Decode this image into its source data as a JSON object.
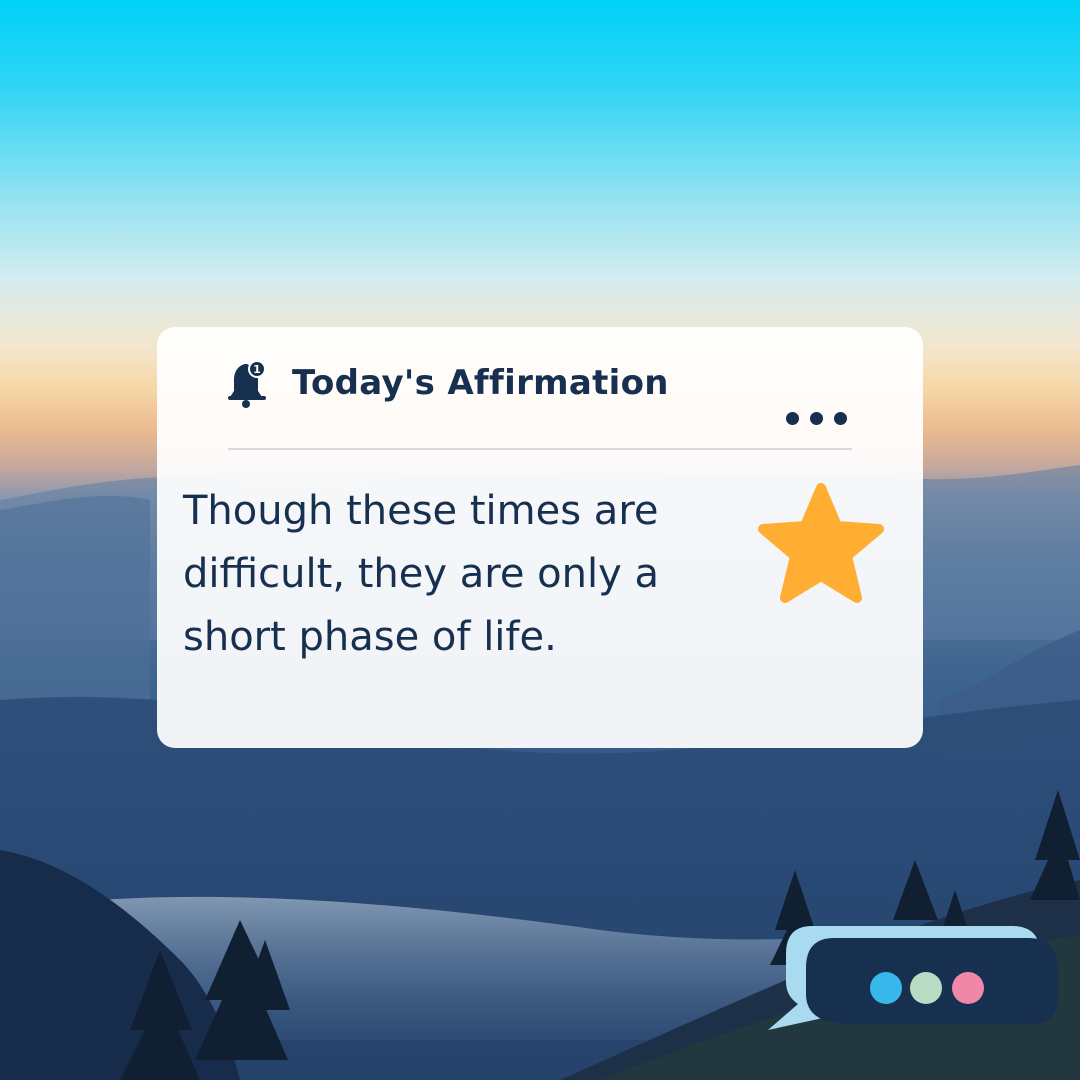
{
  "card": {
    "title": "Today's Affirmation",
    "notification_count": "1",
    "message": "Though these times are difficult, they are only a short phase of life."
  },
  "icons": {
    "bell": "bell-notification-icon",
    "more": "more-options-icon",
    "star": "star-icon",
    "chat": "chat-bubble-icon"
  },
  "colors": {
    "text": "#17304f",
    "star": "#ffae33",
    "chat_bubble_back": "#a8daf0",
    "chat_bubble_front": "#17304f",
    "chat_dot_1": "#38b8ea",
    "chat_dot_2": "#b7dcc3",
    "chat_dot_3": "#ee87a8"
  }
}
